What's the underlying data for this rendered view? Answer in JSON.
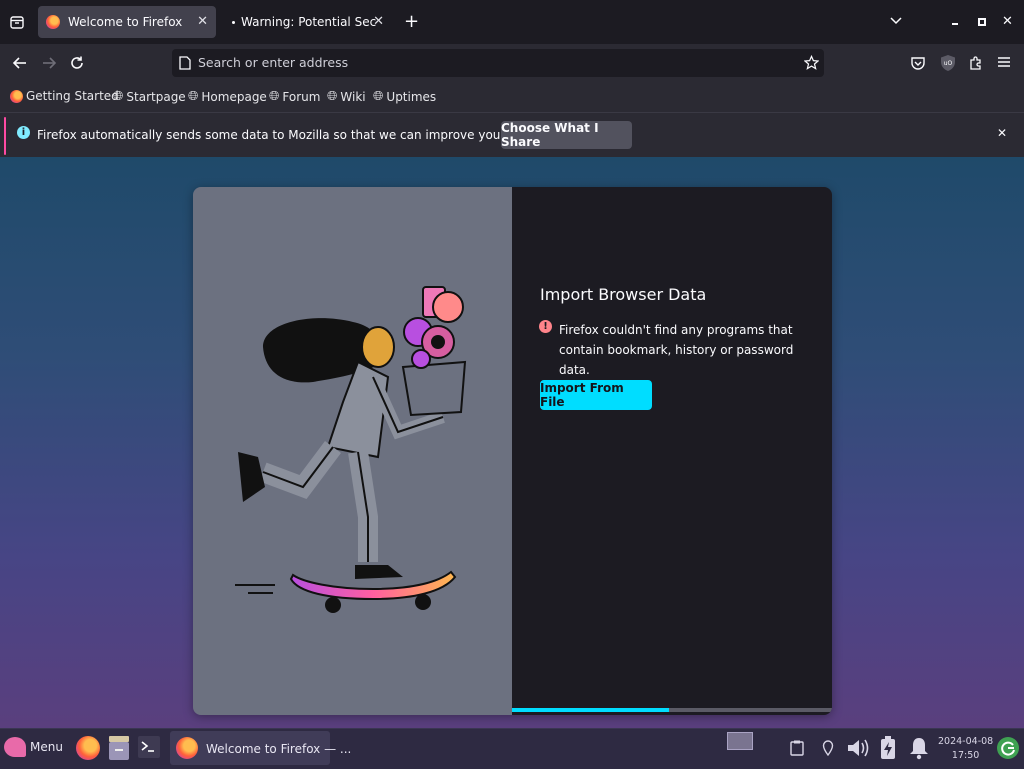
{
  "tabs": [
    {
      "title": "Welcome to Firefox",
      "active": true
    },
    {
      "title": "Warning: Potential Securit",
      "active": false
    }
  ],
  "toolbar": {
    "address_placeholder": "Search or enter address"
  },
  "bookmarks": [
    {
      "label": "Getting Started",
      "icon": "firefox-icon"
    },
    {
      "label": "Startpage",
      "icon": "globe-icon"
    },
    {
      "label": "Homepage",
      "icon": "globe-icon"
    },
    {
      "label": "Forum",
      "icon": "globe-icon"
    },
    {
      "label": "Wiki",
      "icon": "globe-icon"
    },
    {
      "label": "Uptimes",
      "icon": "globe-icon"
    }
  ],
  "notification": {
    "message": "Firefox automatically sends some data to Mozilla so that we can improve your experience.",
    "button_label": "Choose What I Share"
  },
  "import_card": {
    "title": "Import Browser Data",
    "warning": "Firefox couldn't find any programs that contain bookmark, history or password data.",
    "button_label": "Import From File",
    "progress_fraction": 0.49
  },
  "taskbar": {
    "menu_label": "Menu",
    "window_title": "Welcome to Firefox — ...",
    "date": "2024-04-08",
    "time": "17:50"
  },
  "colors": {
    "accent": "#00ddff",
    "notice_accent": "#ff4aa2",
    "tab_active": "#42414d",
    "chrome": "#2b2a33",
    "warning": "#ff848b"
  }
}
